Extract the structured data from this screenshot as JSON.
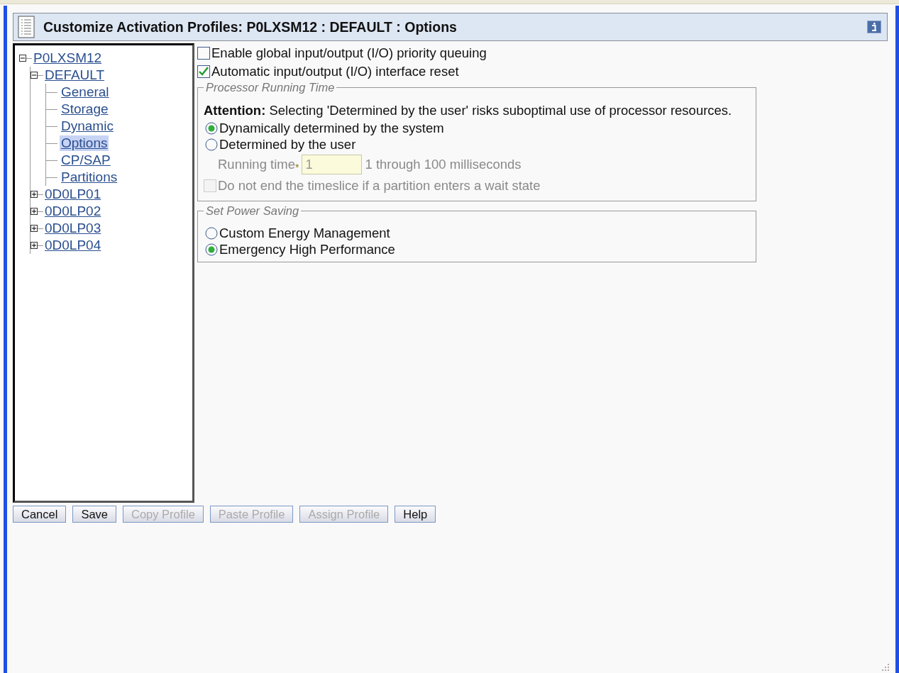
{
  "window": {
    "title": "Customize Activation Profiles: P0LXSM12 : DEFAULT : Options"
  },
  "tree": [
    {
      "label": "P0LXSM12",
      "expanded": true,
      "selected": false,
      "children": [
        {
          "label": "DEFAULT",
          "expanded": true,
          "selected": false,
          "children": [
            {
              "label": "General",
              "selected": false
            },
            {
              "label": "Storage",
              "selected": false
            },
            {
              "label": "Dynamic",
              "selected": false
            },
            {
              "label": "Options",
              "selected": true
            },
            {
              "label": "CP/SAP",
              "selected": false
            },
            {
              "label": "Partitions",
              "selected": false
            }
          ]
        },
        {
          "label": "0D0LP01",
          "expanded": false,
          "selected": false
        },
        {
          "label": "0D0LP02",
          "expanded": false,
          "selected": false
        },
        {
          "label": "0D0LP03",
          "expanded": false,
          "selected": false
        },
        {
          "label": "0D0LP04",
          "expanded": false,
          "selected": false
        }
      ]
    }
  ],
  "options": [
    {
      "label": "Enable global input/output (I/O) priority queuing",
      "checked": false
    },
    {
      "label": "Automatic input/output (I/O) interface reset",
      "checked": true
    }
  ],
  "processor_running_time": {
    "legend": "Processor Running Time",
    "attention": "**Attention:** Selecting 'Determined by the user' risks suboptimal use of processor resources.",
    "radios": [
      {
        "label": "Dynamically determined by the system",
        "selected": true
      },
      {
        "label": "Determined by the user",
        "selected": false
      }
    ],
    "running_time": {
      "label": "Running time",
      "required_mark": "*",
      "value": "1",
      "hint": "1 through 100 milliseconds",
      "disabled": true
    },
    "wait_option": {
      "label": "Do not end the timeslice if a partition enters a wait state",
      "checked": false,
      "disabled": true
    }
  },
  "power_saving": {
    "legend": "Set Power Saving",
    "radios": [
      {
        "label": "Custom Energy Management",
        "selected": false
      },
      {
        "label": "Emergency High Performance",
        "selected": true
      }
    ]
  },
  "buttons": [
    {
      "label": "Cancel",
      "disabled": false
    },
    {
      "label": "Save",
      "disabled": false
    },
    {
      "label": "Copy Profile",
      "disabled": true
    },
    {
      "label": "Paste Profile",
      "disabled": true
    },
    {
      "label": "Assign Profile",
      "disabled": true
    },
    {
      "label": "Help",
      "disabled": false
    }
  ]
}
